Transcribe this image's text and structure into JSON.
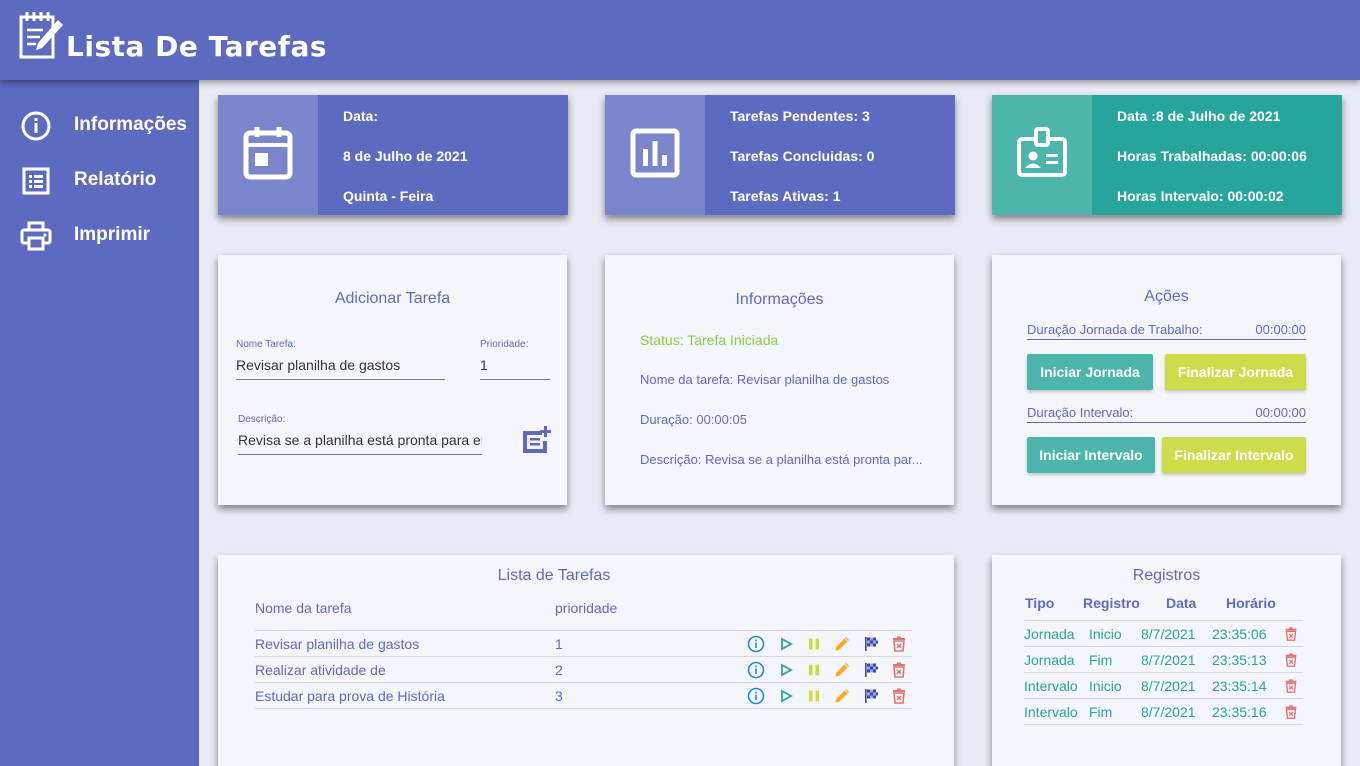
{
  "app": {
    "title": "Lista De Tarefas"
  },
  "sidebar": {
    "items": [
      {
        "label": "Informações",
        "icon": "info-icon"
      },
      {
        "label": "Relatório",
        "icon": "list-icon"
      },
      {
        "label": "Imprimir",
        "icon": "printer-icon"
      }
    ]
  },
  "stats": {
    "date_card": {
      "icon": "calendar-icon",
      "line1": "Data:",
      "line2": "8 de Julho de 2021",
      "line3": "Quinta - Feira"
    },
    "tasks_card": {
      "icon": "bar-chart-icon",
      "line1": "Tarefas Pendentes: 3",
      "line2": "Tarefas Concluidas: 0",
      "line3": "Tarefas Ativas: 1"
    },
    "hours_card": {
      "icon": "id-badge-icon",
      "line1": "Data :8 de Julho de 2021",
      "line2": "Horas Trabalhadas: 00:00:06",
      "line3": "Horas Intervalo: 00:00:02"
    }
  },
  "add_task": {
    "title": "Adicionar Tarefa",
    "name_label": "Nome Tarefa:",
    "name_value": "Revisar planilha de gastos",
    "priority_label": "Prioridade:",
    "priority_value": "1",
    "desc_label": "Descrição:",
    "desc_value": "Revisa se a planilha está pronta para er"
  },
  "info": {
    "title": "Informações",
    "status": "Status: Tarefa Iniciada",
    "task_name": "Nome da tarefa: Revisar planilha de gastos",
    "duration": "Duração: 00:00:05",
    "description": "Descrição: Revisa se a planilha está pronta par..."
  },
  "actions": {
    "title": "Ações",
    "work_label": "Duração Jornada de Trabalho:",
    "work_value": "00:00:00",
    "start_work": "Iniciar Jornada",
    "end_work": "Finalizar Jornada",
    "break_label": "Duração Intervalo:",
    "break_value": "00:00:00",
    "start_break": "Iniciar Intervalo",
    "end_break": "Finalizar Intervalo"
  },
  "task_list": {
    "title": "Lista de Tarefas",
    "col_name": "Nome da tarefa",
    "col_priority": "prioridade",
    "rows": [
      {
        "name": "Revisar planilha de gastos",
        "priority": "1"
      },
      {
        "name": "Realizar atividade de",
        "priority": "2"
      },
      {
        "name": "Estudar para prova de História",
        "priority": "3"
      }
    ],
    "row_icons": [
      "info-icon",
      "play-icon",
      "pause-icon",
      "edit-pencil-icon",
      "finish-flag-icon",
      "delete-trash-icon"
    ]
  },
  "records": {
    "title": "Registros",
    "col_type": "Tipo",
    "col_record": "Registro",
    "col_date": "Data",
    "col_time": "Horário",
    "rows": [
      {
        "type": "Jornada",
        "record": "Inicio",
        "date": "8/7/2021",
        "time": "23:35:06"
      },
      {
        "type": "Jornada",
        "record": "Fim",
        "date": "8/7/2021",
        "time": "23:35:13"
      },
      {
        "type": "Intervalo",
        "record": "Inicio",
        "date": "8/7/2021",
        "time": "23:35:14"
      },
      {
        "type": "Intervalo",
        "record": "Fim",
        "date": "8/7/2021",
        "time": "23:35:16"
      }
    ]
  },
  "colors": {
    "primary": "#5c6bc0",
    "primary_light": "#7986cb",
    "teal": "#26a69a",
    "teal_light": "#4db6ac",
    "lime": "#cddc4a",
    "status_green": "#7cd33c",
    "danger": "#e57373"
  }
}
